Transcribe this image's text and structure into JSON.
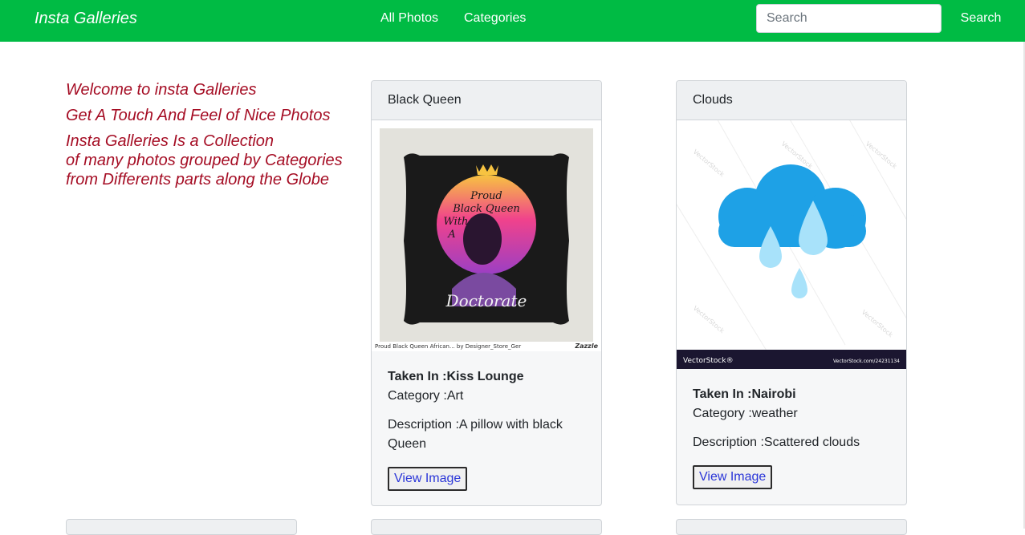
{
  "nav": {
    "brand": "Insta Galleries",
    "links": [
      "All Photos",
      "Categories"
    ],
    "search_placeholder": "Search",
    "search_button": "Search"
  },
  "intro": {
    "line1": "Welcome to insta Galleries",
    "line2": "Get A Touch And Feel of Nice Photos",
    "line3a": "Insta Galleries Is a Collection",
    "line3b": "of many photos grouped by Categories",
    "line3c": "from Differents parts along the Globe"
  },
  "cards": [
    {
      "title": "Black Queen",
      "taken_in": "Taken In :Kiss Lounge",
      "category": "Category :Art",
      "description": "Description :A pillow with black Queen",
      "button": "View Image",
      "image": {
        "text_top": [
          "Proud",
          "Black Queen",
          "With",
          "A"
        ],
        "text_bottom": "Doctorate",
        "caption": "Proud Black Queen African... by Designer_Store_Ger",
        "brand": "Zazzle"
      }
    },
    {
      "title": "Clouds",
      "taken_in": "Taken In :Nairobi",
      "category": "Category :weather",
      "description": "Description :Scattered clouds",
      "button": "View Image",
      "image": {
        "watermark": "VectorStock",
        "footer_left": "VectorStock®",
        "footer_right": "VectorStock.com/24231134"
      }
    }
  ],
  "colors": {
    "navbar": "#00bb44",
    "intro_text": "#a50d24",
    "link_blue": "#2a35d8"
  }
}
